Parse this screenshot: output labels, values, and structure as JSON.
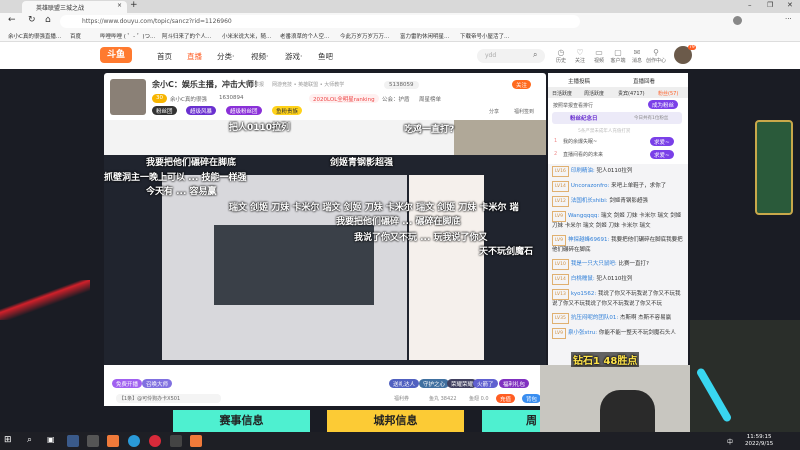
{
  "browser": {
    "tab_title": "英雄联盟三城之战",
    "url": "https://www.douyu.com/topic/sancz?rid=1126960",
    "bookmarks": [
      "余小C真的很强直播...",
      "百度",
      "哔哩哔哩 ( ゜- ゜)つ...",
      "阿斗归来了的个人...",
      "小米米说大米，随...",
      "老番浪草的个人空...",
      "今此万岁万岁万万...",
      "富力雷豹休闲明星...",
      "下载帝号小屋活了..."
    ]
  },
  "nav": {
    "logo": "斗鱼",
    "items": [
      "首页",
      "直播",
      "分类·",
      "视频·",
      "游戏·",
      "鱼吧"
    ],
    "search_value": "ydd",
    "tools": [
      {
        "icon": "history-icon",
        "label": "历史"
      },
      {
        "icon": "heart-icon",
        "label": "关注"
      },
      {
        "icon": "video-icon",
        "label": "视频"
      },
      {
        "icon": "client-icon",
        "label": "客户端"
      },
      {
        "icon": "message-icon",
        "label": "消息"
      },
      {
        "icon": "creator-icon",
        "label": "创作中心"
      }
    ],
    "avatar_badge": "79"
  },
  "room": {
    "title": "余小C：娱乐主播，冲击大师！",
    "report": "举报",
    "category": "网游竞技 • 英雄联盟 • 大师教学",
    "anchor": "余小C真的很强",
    "hot": "1630894",
    "rank_badge": "2020LOL全明星ranking",
    "announce": "公会：护盾",
    "tag": "周星榜单",
    "fans": "5138059",
    "follow": "关注",
    "share": "分享",
    "welfare": "福利签到",
    "badges": [
      "粉丝团",
      "超级风暴",
      "超级粉丝团",
      "鱼粉贵族"
    ],
    "level": "30"
  },
  "danmaku": [
    "把人0110拉列",
    "吃鸡一直打?",
    "我要把他们碾碎在脚底",
    "剑姬青钢影超强",
    "抓壁洞主一晚上可以 ... 技能一样强",
    "今天有 ... 容易赢",
    "瑞文 剑姬 刀妹 卡米尔 瑞文 剑姬 刀妹 卡米尔 瑞文 剑姬 刀妹 卡米尔 瑞",
    "我要把他们碾碎 ... 碾碎在脚底",
    "我说了你又不玩 ... 玩我说了你又",
    "天不玩剑魔石"
  ],
  "giftbar": {
    "left_gifts": [
      "免费开播",
      "召唤大师"
    ],
    "right_gifts": [
      "送礼达人",
      "守护之心",
      "荣耀荣耀",
      "火箭了",
      "福利礼包"
    ],
    "notice": "【1条】@可伶狗办卡X501",
    "welfare": "福利券",
    "fish_balls": "鱼丸 38422",
    "fish_fins": "鱼翅 0.0",
    "recharge": "充值",
    "backpack": "背包"
  },
  "chat": {
    "top_tabs": [
      "主播投稿",
      "直播回看"
    ],
    "tabs": [
      "日活跃度",
      "周活跃度",
      "贵宾(4717)",
      "粉丝(57)"
    ],
    "hint": "按照举报查看排行",
    "become_fan": "成为粉丝",
    "anniversary": "粉丝纪念日",
    "today": "今日共有1位粉丝",
    "notice": "5条严禁未成年人充值打赏",
    "ranks": [
      {
        "n": "1",
        "t": "我的余爆失眠~",
        "b": "求爱~"
      },
      {
        "n": "2",
        "t": "直播间看的的未来",
        "b": "求爱~"
      }
    ],
    "messages": [
      {
        "lv": "LV16",
        "user": "印刷精油:",
        "text": "犯人0110拉列"
      },
      {
        "lv": "LV14",
        "user": "Uncorazonfro:",
        "text": "来吧上单鞋子，求你了"
      },
      {
        "lv": "LV12",
        "user": "法国机长shibi:",
        "text": "剑姬青钢影超强"
      },
      {
        "lv": "LV9",
        "user": "Wangqqqq:",
        "text": "瑞文 剑姬 刀妹 卡米尔 瑞文 剑姬 刀妹 卡米尔 瑞文 剑姬 刀妹 卡米尔 瑞文"
      },
      {
        "lv": "LV9",
        "user": "神探越峰69691:",
        "text": "我要把他们碾碎在脚底我要把他们碾碎在脚底"
      },
      {
        "lv": "LV10",
        "user": "我是一只大只鼠吧:",
        "text": "比赛一直打?"
      },
      {
        "lv": "LV14",
        "user": "白桃糯鼠:",
        "text": "犯人0110拉列"
      },
      {
        "lv": "LV13",
        "user": "kyo1562:",
        "text": "我说了你又不玩我说了你又不玩我说了你又不玩我说了你又不玩我说了你又不玩"
      },
      {
        "lv": "LV35",
        "user": "抗压闷呢的团队01:",
        "text": "杰斯啊 杰斯不容易赢"
      },
      {
        "lv": "LV9",
        "user": "泉小张stru:",
        "text": "你能不能一整天不玩剑魔石头人"
      }
    ]
  },
  "overlay": {
    "rank_text": "钻石1 48胜点"
  },
  "banners": [
    {
      "label": "赛事信息",
      "color": "#4ef0d0"
    },
    {
      "label": "城邦信息",
      "color": "#fccb35"
    },
    {
      "label": "周",
      "color": "#4ef0d0"
    }
  ],
  "taskbar": {
    "time": "11:59:15",
    "date": "2022/9/15",
    "ime": "中"
  }
}
